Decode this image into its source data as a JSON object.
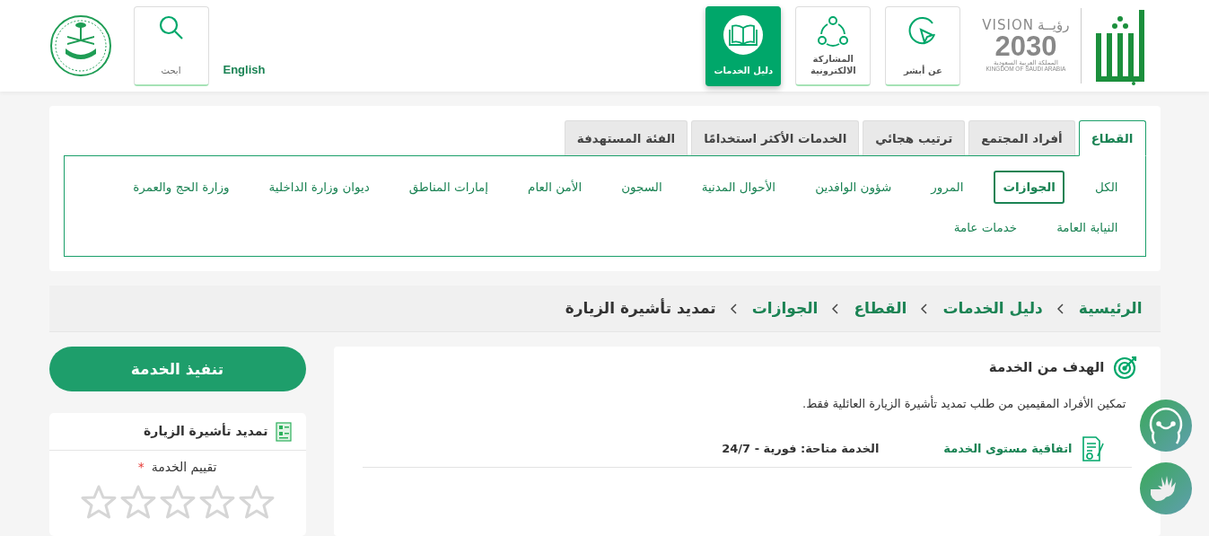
{
  "header": {
    "vision_logo": {
      "arabic": "رؤيــة",
      "latin": "VISION",
      "year": "2030",
      "country_ar": "المملكة العربية السعودية",
      "country_en": "KINGDOM OF SAUDI ARABIA"
    },
    "nav": [
      {
        "label": "عن أبشر",
        "selected": false
      },
      {
        "label": "المشاركة الالكترونية",
        "selected": false
      },
      {
        "label": "دليل الخدمات",
        "selected": true
      }
    ],
    "language": "English",
    "search": "ابحث"
  },
  "tabs": [
    {
      "label": "القطاع",
      "selected": true
    },
    {
      "label": "أفراد المجتمع",
      "selected": false
    },
    {
      "label": "ترتيب هجائي",
      "selected": false
    },
    {
      "label": "الخدمات الأكثر استخدامًا",
      "selected": false
    },
    {
      "label": "الفئة المستهدفة",
      "selected": false
    }
  ],
  "sector_rows": [
    [
      {
        "label": "الكل",
        "selected": false
      },
      {
        "label": "الجوازات",
        "selected": true
      },
      {
        "label": "المرور",
        "selected": false
      },
      {
        "label": "شؤون الوافدين",
        "selected": false
      },
      {
        "label": "الأحوال المدنية",
        "selected": false
      },
      {
        "label": "السجون",
        "selected": false
      },
      {
        "label": "الأمن العام",
        "selected": false
      },
      {
        "label": "إمارات المناطق",
        "selected": false
      },
      {
        "label": "ديوان وزارة الداخلية",
        "selected": false
      },
      {
        "label": "وزارة الحج والعمرة",
        "selected": false
      }
    ],
    [
      {
        "label": "النيابة العامة",
        "selected": false
      },
      {
        "label": "خدمات عامة",
        "selected": false
      }
    ]
  ],
  "breadcrumb": [
    {
      "label": "الرئيسية",
      "current": false
    },
    {
      "label": "دليل الخدمات",
      "current": false
    },
    {
      "label": "القطاع",
      "current": false
    },
    {
      "label": "الجوازات",
      "current": false
    },
    {
      "label": "تمديد تأشيرة الزيارة",
      "current": true
    }
  ],
  "goal": {
    "title": "الهدف من الخدمة",
    "text": "تمكين الأفراد المقيمين من طلب تمديد تأشيرة الزيارة العائلية فقط.",
    "sla_link": "اتفاقية مستوى الخدمة",
    "availability": "الخدمة متاحة: فورية - 24/7"
  },
  "execute_button": "تنفيذ الخدمة",
  "side_card": {
    "title": "تمديد تأشيرة الزيارة",
    "rating_label": "تقييم الخدمة",
    "required_mark": "*",
    "stars": 0
  }
}
